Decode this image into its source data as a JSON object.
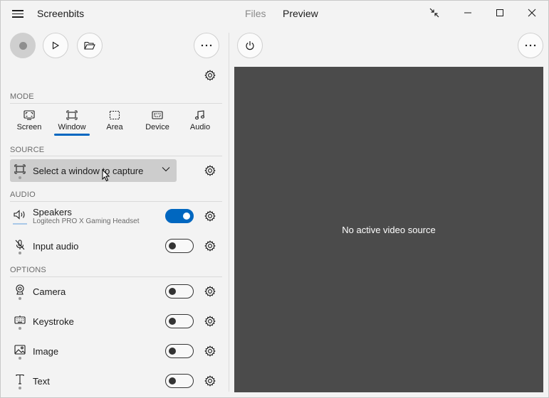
{
  "app": {
    "title": "Screenbits"
  },
  "tabs": {
    "files": "Files",
    "preview": "Preview"
  },
  "window_controls": {
    "compact": "compact-overlay-icon",
    "minimize": "minimize-icon",
    "maximize": "maximize-icon",
    "close": "close-icon"
  },
  "toolbar": {
    "record": "record-icon",
    "play": "play-icon",
    "open": "folder-open-icon",
    "more": "more-icon",
    "power": "power-icon"
  },
  "mode": {
    "label": "MODE",
    "selected": "Window",
    "items": [
      {
        "label": "Screen",
        "icon": "screen-icon"
      },
      {
        "label": "Window",
        "icon": "window-icon"
      },
      {
        "label": "Area",
        "icon": "area-icon"
      },
      {
        "label": "Device",
        "icon": "device-icon"
      },
      {
        "label": "Audio",
        "icon": "audio-note-icon"
      }
    ]
  },
  "source": {
    "label": "SOURCE",
    "placeholder": "Select a window to capture"
  },
  "audio": {
    "label": "AUDIO",
    "speakers": {
      "label": "Speakers",
      "device": "Logitech PRO X Gaming Headset",
      "enabled": true
    },
    "input": {
      "label": "Input audio",
      "enabled": false
    }
  },
  "options": {
    "label": "OPTIONS",
    "items": [
      {
        "label": "Camera",
        "enabled": false
      },
      {
        "label": "Keystroke",
        "enabled": false
      },
      {
        "label": "Image",
        "enabled": false
      },
      {
        "label": "Text",
        "enabled": false
      }
    ]
  },
  "preview": {
    "empty_text": "No active video source",
    "background": "#4b4b4b"
  },
  "colors": {
    "accent": "#0067c0",
    "background": "#f3f3f3"
  }
}
